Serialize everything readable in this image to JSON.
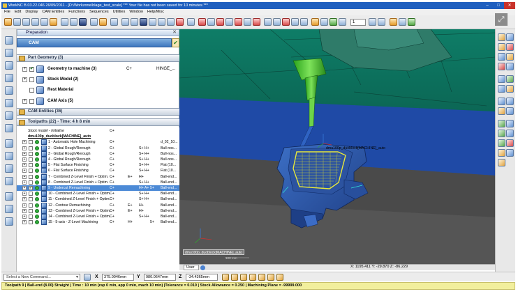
{
  "window": {
    "title": "WorkNC  B 03.22.046  26/09/2011 - [D:\\Workzone\\blage_test_scale]  ***  Your file has not been saved for 10 minutes  ***",
    "minimize": "–",
    "maximize": "□",
    "close": "✕"
  },
  "menu": [
    "File",
    "Edit",
    "Display",
    "CAM Entities",
    "Functions",
    "Sequences",
    "Utilities",
    "Window",
    "Help/Misc"
  ],
  "toolbar": {
    "spinner_value": "1"
  },
  "panel": {
    "title": "Preparation",
    "close_glyph": "✕",
    "cam_label": "CAM",
    "cam_confirm_glyph": "✔",
    "part_geometry_header": "Part Geometry (3)",
    "part_geometry": [
      {
        "expander": "+",
        "checked": "✔",
        "name": "Geometry to machine (3)",
        "c1": "C+",
        "c2": "HINGE_..."
      },
      {
        "expander": "+",
        "checked": "",
        "name": "Stock Model (2)",
        "c1": "",
        "c2": ""
      },
      {
        "expander": "",
        "checked": "",
        "name": "Rest Material",
        "c1": "",
        "c2": ""
      },
      {
        "expander": "+",
        "checked": "",
        "name": "CAM Axis (5)",
        "c1": "",
        "c2": ""
      }
    ],
    "cam_entities_header": "CAM Entities (36)",
    "toolpaths_header": "Toolpaths (22) - Time: 4 h 8 min",
    "toolpaths": [
      {
        "type": "plain",
        "name": "Stock model - Initialise",
        "c1": "C+",
        "c2": "",
        "c3": "",
        "c4": "",
        "c5": ""
      },
      {
        "type": "group",
        "name": "dmu100p_duoblock[MACHINE]_auto",
        "c1": "",
        "c2": "",
        "c3": "",
        "c4": "",
        "c5": ""
      },
      {
        "type": "item",
        "expander": "+",
        "checked": "",
        "name": "1 - Automatic Hole Machining",
        "c1": "C+",
        "c2": "",
        "c3": "",
        "c4": "",
        "c5": "d_02_10..."
      },
      {
        "type": "item",
        "expander": "+",
        "checked": "",
        "name": "2 - Global Rough/Rerough",
        "c1": "C+",
        "c2": "",
        "c3": "S+ H+",
        "c4": "",
        "c5": "Bull-nos..."
      },
      {
        "type": "item",
        "expander": "+",
        "checked": "",
        "name": "3 - Global Rough/Rerough",
        "c1": "C+",
        "c2": "",
        "c3": "S+ H+",
        "c4": "",
        "c5": "Bull-nos..."
      },
      {
        "type": "item",
        "expander": "+",
        "checked": "",
        "name": "4 - Global Rough/Rerough",
        "c1": "C+",
        "c2": "",
        "c3": "S+ H+",
        "c4": "",
        "c5": "Bull-nos..."
      },
      {
        "type": "item",
        "expander": "+",
        "checked": "",
        "name": "5 - Flat Surface Finishing",
        "c1": "C+",
        "c2": "",
        "c3": "S+ H+",
        "c4": "",
        "c5": "Flat (10..."
      },
      {
        "type": "item",
        "expander": "+",
        "checked": "",
        "name": "6 - Flat Surface Finishing",
        "c1": "C+",
        "c2": "",
        "c3": "S+ H+",
        "c4": "",
        "c5": "Flat (10..."
      },
      {
        "type": "item",
        "expander": "+",
        "checked": "",
        "name": "7 - Combined Z-Level Finish + Optim.",
        "c1": "C+",
        "c2": "E+",
        "c3": "H+",
        "c4": "",
        "c5": "Ball-end..."
      },
      {
        "type": "item",
        "expander": "+",
        "checked": "",
        "name": "8 - Combined Z-Level Finish + Optim.",
        "c1": "C+",
        "c2": "",
        "c3": "S+ H+",
        "c4": "",
        "c5": "Ball-end..."
      },
      {
        "type": "item",
        "selected": true,
        "expander": "+",
        "checked": "✔",
        "name": "9 - Undercut Remachining",
        "c1": "C+",
        "c2": "",
        "c3": "H+ A+",
        "c4": "5+",
        "c5": "Ball-end..."
      },
      {
        "type": "item",
        "expander": "+",
        "checked": "",
        "name": "10 - Combined Z-Level Finish + Optim.",
        "c1": "C+",
        "c2": "",
        "c3": "S+ H+",
        "c4": "",
        "c5": "Ball-end..."
      },
      {
        "type": "item",
        "expander": "+",
        "checked": "",
        "name": "11 - Combined Z-Level Finish + Optim.",
        "c1": "C+",
        "c2": "",
        "c3": "S+ H+",
        "c4": "",
        "c5": "Ball-end..."
      },
      {
        "type": "item",
        "expander": "+",
        "checked": "",
        "name": "12 - Contour Remachining",
        "c1": "C+",
        "c2": "E+",
        "c3": "H+",
        "c4": "",
        "c5": "Ball-end..."
      },
      {
        "type": "item",
        "expander": "+",
        "checked": "",
        "name": "13 - Combined Z-Level Finish + Optim.",
        "c1": "C+",
        "c2": "E+",
        "c3": "H+",
        "c4": "",
        "c5": "Ball-end..."
      },
      {
        "type": "item",
        "expander": "+",
        "checked": "",
        "name": "14 - Combined Z-Level Finish + Optim.",
        "c1": "C+",
        "c2": "",
        "c3": "S+ H+",
        "c4": "",
        "c5": "Ball-end..."
      },
      {
        "type": "item",
        "expander": "+",
        "checked": "",
        "name": "15 - 5-axis - Z-Level Machining",
        "c1": "C+",
        "c2": "H+",
        "c3": "",
        "c4": "5+",
        "c5": "Ball-end..."
      }
    ]
  },
  "viewport": {
    "machine_label": "dmu100p_duoblock[MACHINE]_auto",
    "machine_label_bottom": "dmu100p_duoblock[MACHINE]_auto",
    "scale_label": "100 mm"
  },
  "tabs": {
    "user": "User"
  },
  "coords": "X: 1195.411    Y: -29.870    Z: -86.229",
  "command": {
    "placeholder": "Select a New Command...",
    "dropdown_glyph": "▼",
    "x_label": "X",
    "x_value": "375.0046mm",
    "y_label": "Y",
    "y_value": "980.0647mm",
    "z_label": "Z",
    "z_value": "-34.4365mm"
  },
  "status": "Toolpath 9 | Ball-end (8.00) Straight | Time : 10 min (rap 0 min, app 0 min, mach 10 min) |Tolerance = 0.010 | Stock Allowance = 0.250 | Machining Plane = -99999.000",
  "expand_glyph": "⤢",
  "colors": {
    "title_bar": "#1f5fbf",
    "selection": "#4c8ad6",
    "status_bar": "#f2ef9d",
    "part_blue": "#2d5aa8",
    "spindle_green": "#43c12a",
    "toolpath_yellow": "#e8e83a"
  }
}
